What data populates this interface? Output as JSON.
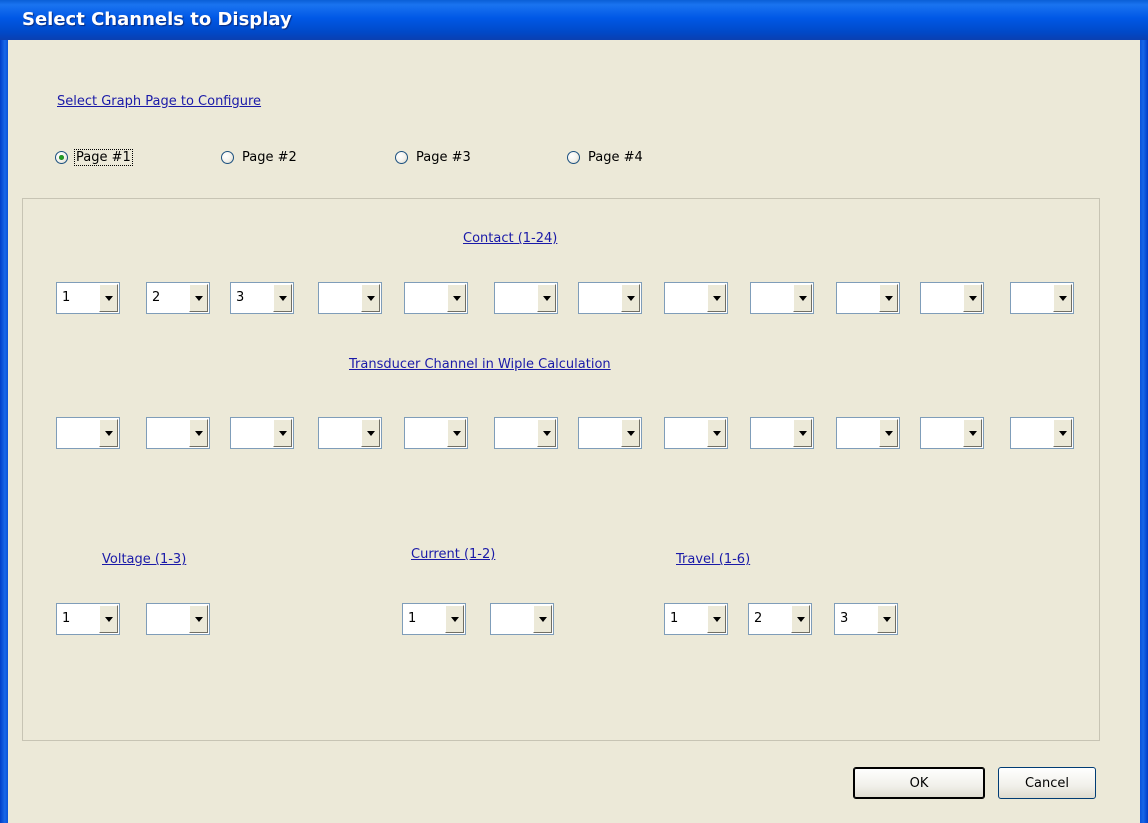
{
  "window": {
    "title": "Select Channels to Display"
  },
  "page_select": {
    "label": "Select Graph Page to Configure",
    "options": [
      {
        "label": "Page #1",
        "checked": true
      },
      {
        "label": "Page #2",
        "checked": false
      },
      {
        "label": "Page #3",
        "checked": false
      },
      {
        "label": "Page #4",
        "checked": false
      }
    ]
  },
  "contact": {
    "label": "Contact (1-24)",
    "values": [
      "1",
      "2",
      "3",
      "",
      "",
      "",
      "",
      "",
      "",
      "",
      "",
      ""
    ]
  },
  "transducer": {
    "label": "Transducer Channel in Wiple Calculation",
    "values": [
      "",
      "",
      "",
      "",
      "",
      "",
      "",
      "",
      "",
      "",
      "",
      ""
    ]
  },
  "voltage": {
    "label": "Voltage (1-3)",
    "values": [
      "1",
      ""
    ]
  },
  "current": {
    "label": "Current (1-2)",
    "values": [
      "1",
      ""
    ]
  },
  "travel": {
    "label": "Travel (1-6)",
    "values": [
      "1",
      "2",
      "3"
    ]
  },
  "buttons": {
    "ok": "OK",
    "cancel": "Cancel"
  }
}
